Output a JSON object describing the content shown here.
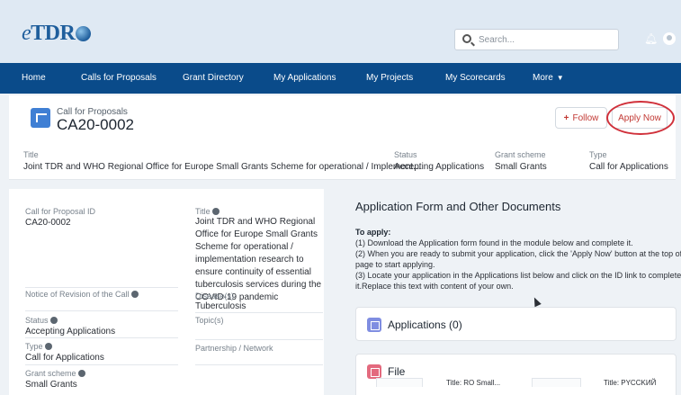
{
  "app": {
    "logo_prefix": "e",
    "logo_rest": "TDR"
  },
  "search": {
    "placeholder": "Search..."
  },
  "nav": {
    "items": [
      "Home",
      "Calls for Proposals",
      "Grant Directory",
      "My Applications",
      "My Projects",
      "My Scorecards",
      "More"
    ]
  },
  "record": {
    "object_type": "Call for Proposals",
    "name": "CA20-0002",
    "follow_label": "Follow",
    "apply_label": "Apply Now",
    "highlight_color": "#d0303a",
    "fields": {
      "title_label": "Title",
      "title_value": "Joint TDR and WHO Regional Office for Europe Small Grants Scheme for operational / Implement...",
      "status_label": "Status",
      "status_value": "Accepting Applications",
      "scheme_label": "Grant scheme",
      "scheme_value": "Small Grants",
      "type_label": "Type",
      "type_value": "Call for Applications"
    }
  },
  "details": {
    "id_label": "Call for Proposal ID",
    "id_value": "CA20-0002",
    "title_label": "Title",
    "title_value": "Joint TDR and WHO Regional Office for Europe Small Grants Scheme for operational / implementation research to ensure continuity of essential tuberculosis services during the COVID-19 pandemic",
    "notice_label": "Notice of Revision of the Call",
    "disease_label": "Disease(s)",
    "disease_value": "Tuberculosis",
    "status_label": "Status",
    "status_value": "Accepting Applications",
    "topic_label": "Topic(s)",
    "type_label": "Type",
    "type_value": "Call for Applications",
    "partnership_label": "Partnership / Network",
    "scheme_label": "Grant scheme",
    "scheme_value": "Small Grants"
  },
  "content": {
    "section_title": "Application Form and Other Documents",
    "to_apply": "To apply:",
    "steps": [
      "(1) Download the Application form found in the module below and complete it.",
      "(2) When you are ready to submit your application, click the 'Apply Now' button at the top of the",
      "page to start applying.",
      "(3) Locate your application in the Applications list below and click on the ID link to complete",
      "it.Replace this text with content of your own."
    ],
    "applications_title": "Applications (0)",
    "file_title": "File",
    "file_caption_1": "Title: RO Small...",
    "file_caption_2": "Title: PYCCKИЙ"
  },
  "colors": {
    "nav_bg": "#0a4b8a",
    "header_bg": "#dfe9f3",
    "record_icon": "#3f7fd4",
    "applications_icon": "#7f8de1",
    "file_icon": "#e36a7e",
    "action_text": "#c23934"
  },
  "icons": [
    "search-icon",
    "bell-icon",
    "user-avatar-icon",
    "chevron-down-icon",
    "record-type-icon",
    "info-icon",
    "applications-icon",
    "file-icon",
    "mouse-cursor-icon"
  ]
}
